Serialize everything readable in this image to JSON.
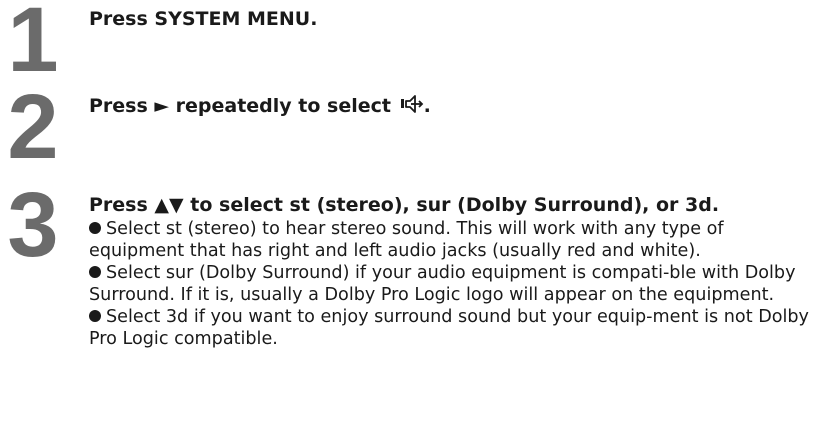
{
  "steps": [
    {
      "number": "1",
      "prefix": "Press SYSTEM MENU",
      "suffix": "."
    },
    {
      "number": "2",
      "prefix": "Press ► repeatedly to select",
      "icon": "speaker-surround-icon",
      "suffix": "."
    },
    {
      "number": "3",
      "instruction": "Press ▲▼ to select st (stereo), sur (Dolby Surround), or 3d."
    }
  ],
  "notes": [
    "Select st (stereo) to hear stereo sound. This will work with any type of equipment that has right and left audio jacks (usually red and white).",
    "Select sur (Dolby Surround) if your audio equipment is compati-ble with Dolby Surround. If it is, usually a Dolby Pro Logic logo will appear on the equipment.",
    "Select 3d if you want to enjoy surround sound but your equip-ment is not Dolby Pro Logic compatible."
  ],
  "colors": {
    "step_number": "#6b6b6b",
    "text": "#1a1a1a"
  }
}
